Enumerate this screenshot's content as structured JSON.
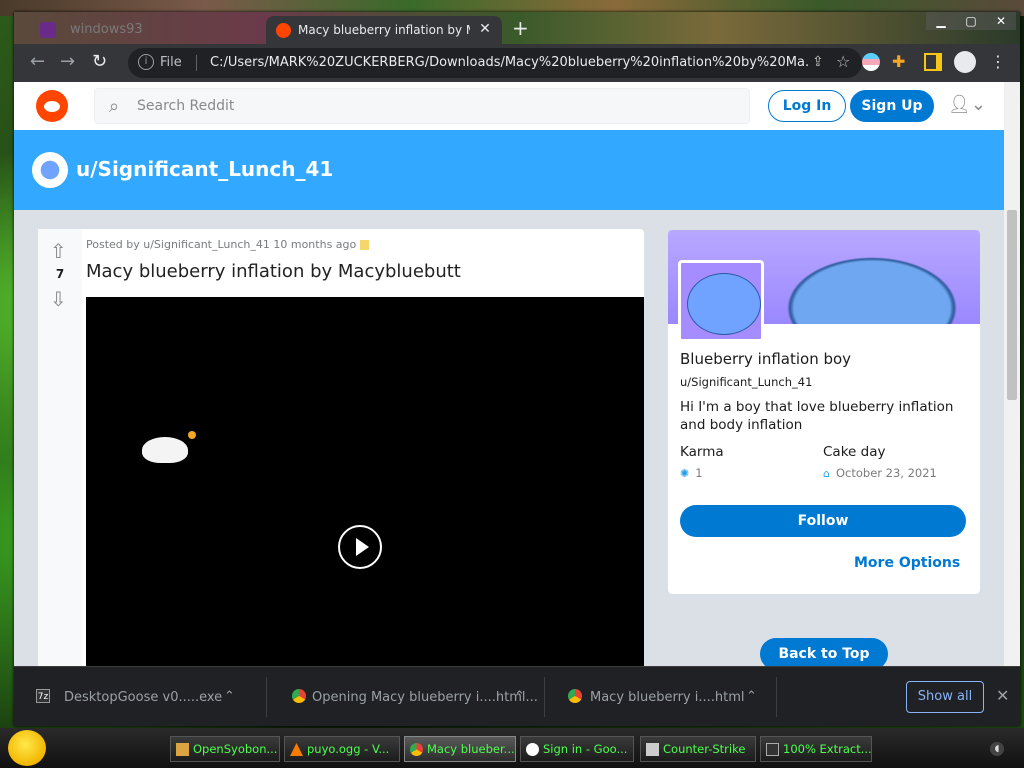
{
  "browser": {
    "inactive_tab_title": "windows93",
    "active_tab_title": "Macy blueberry inflation by Mac",
    "tab_close": "✕",
    "new_tab": "+",
    "scheme_label": "File",
    "url": "C:/Users/MARK%20ZUCKERBERG/Downloads/Macy%20blueberry%20inflation%20by%20Ma..."
  },
  "reddit": {
    "search_placeholder": "Search Reddit",
    "login_label": "Log In",
    "signup_label": "Sign Up",
    "banner_username": "u/Significant_Lunch_41"
  },
  "post": {
    "vote_count": "7",
    "meta": "Posted by u/Significant_Lunch_41 10 months ago",
    "title": "Macy blueberry inflation by Macybluebutt"
  },
  "profile": {
    "display_name": "Blueberry inflation boy",
    "username": "u/Significant_Lunch_41",
    "bio": "Hi I'm a boy that love blueberry inflation and body inflation",
    "karma_label": "Karma",
    "karma_value": "1",
    "cakeday_label": "Cake day",
    "cakeday_value": "October 23, 2021",
    "follow_label": "Follow",
    "more_options_label": "More Options",
    "back_to_top_label": "Back to Top"
  },
  "downloads": {
    "items": [
      {
        "name": "DesktopGoose v0.....exe"
      },
      {
        "name": "Opening Macy blueberry i....html..."
      },
      {
        "name": "Macy blueberry i....html"
      }
    ],
    "show_all_label": "Show all"
  },
  "taskbar": {
    "items": [
      {
        "label": "OpenSyobon..."
      },
      {
        "label": "puyo.ogg - V..."
      },
      {
        "label": "Macy blueber..."
      },
      {
        "label": "Sign in - Goo..."
      },
      {
        "label": "Counter-Strike"
      },
      {
        "label": "100% Extract..."
      }
    ]
  },
  "colors": {
    "reddit_blue": "#0079d3",
    "banner_blue": "#33a8ff",
    "reddit_orange": "#ff4500",
    "taskbar_text": "#4cff4c"
  }
}
